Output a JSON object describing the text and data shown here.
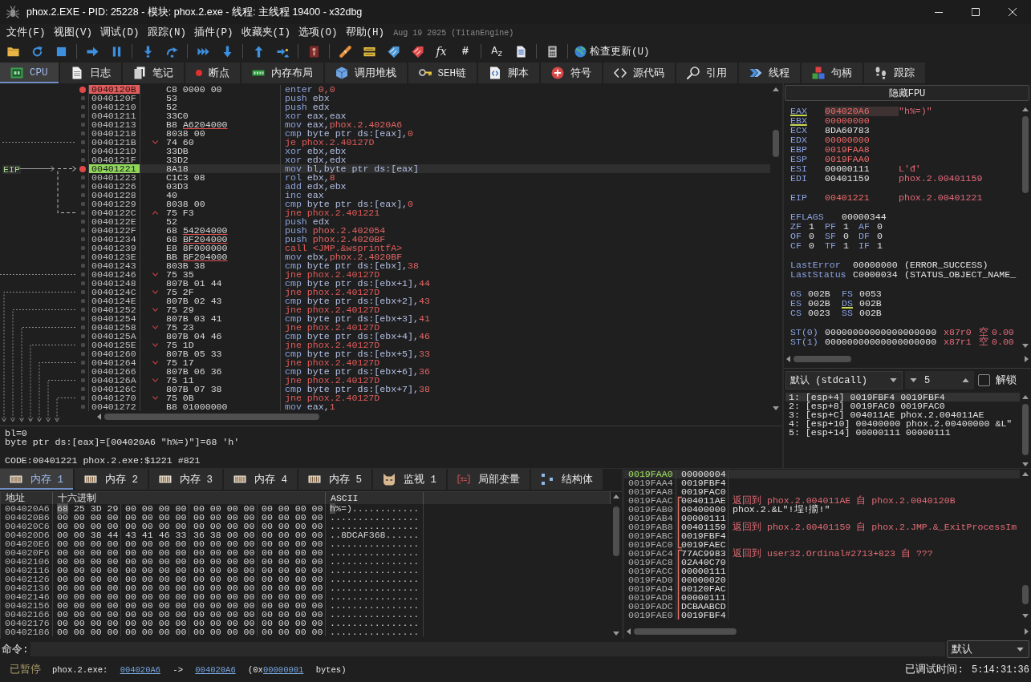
{
  "window": {
    "title": "phox.2.EXE - PID: 25228 - 模块: phox.2.exe - 线程: 主线程 19400 - x32dbg"
  },
  "menu": {
    "items": [
      "文件(F)",
      "视图(V)",
      "调试(D)",
      "跟踪(N)",
      "插件(P)",
      "收藏夹(I)",
      "选项(O)",
      "帮助(H)"
    ],
    "build": "Aug 19 2025 (TitanEngine)"
  },
  "toolbar": {
    "glyphs": [
      "fx",
      "#",
      "A$_{z}$"
    ],
    "update_button": "检查更新(U)"
  },
  "tabs": [
    {
      "label": "CPU",
      "selected": true
    },
    {
      "label": "日志",
      "selected": false
    },
    {
      "label": "笔记",
      "selected": false
    },
    {
      "label": "断点",
      "selected": false
    },
    {
      "label": "内存布局",
      "selected": false
    },
    {
      "label": "调用堆栈",
      "selected": false
    },
    {
      "label": "SEH链",
      "selected": false
    },
    {
      "label": "脚本",
      "selected": false
    },
    {
      "label": "符号",
      "selected": false
    },
    {
      "label": "源代码",
      "selected": false
    },
    {
      "label": "引用",
      "selected": false
    },
    {
      "label": "线程",
      "selected": false
    },
    {
      "label": "句柄",
      "selected": false
    },
    {
      "label": "跟踪",
      "selected": false
    }
  ],
  "disasm": {
    "eip_label": "EIP",
    "rows": [
      {
        "address": "0040120B",
        "bytes": "C8 0000 00",
        "mnemonic": "enter",
        "value": "0,0",
        "kind": "plain",
        "breakpoint": true,
        "current": false
      },
      {
        "address": "0040120F",
        "bytes": "53",
        "mnemonic": "push",
        "operands": "ebx",
        "kind": "plain",
        "breakpoint": false,
        "current": false
      },
      {
        "address": "00401210",
        "bytes": "52",
        "mnemonic": "push",
        "operands": "edx",
        "kind": "plain",
        "breakpoint": false,
        "current": false
      },
      {
        "address": "00401211",
        "bytes": "33C0",
        "mnemonic": "xor",
        "operands": "eax,eax",
        "kind": "plain",
        "breakpoint": false,
        "current": false
      },
      {
        "address": "00401213",
        "bytes": "B8",
        "reloc": "A6204000",
        "mnemonic": "mov",
        "operands": "eax,",
        "value": "phox.2.4020A6",
        "kind": "plain",
        "breakpoint": false,
        "current": false
      },
      {
        "address": "00401218",
        "bytes": "8038 00",
        "mnemonic": "cmp",
        "operands": "byte ptr ds:[eax],",
        "value": "0",
        "kind": "plain",
        "breakpoint": false,
        "current": false
      },
      {
        "address": "0040121B",
        "bytes": "74 60",
        "jump_up": false,
        "mnemonic": "je",
        "value": "phox.2.40127D",
        "kind": "branch",
        "breakpoint": false,
        "current": false
      },
      {
        "address": "0040121D",
        "bytes": "33DB",
        "mnemonic": "xor",
        "operands": "ebx,ebx",
        "kind": "plain",
        "breakpoint": false,
        "current": false
      },
      {
        "address": "0040121F",
        "bytes": "33D2",
        "mnemonic": "xor",
        "operands": "edx,edx",
        "kind": "plain",
        "breakpoint": false,
        "current": false
      },
      {
        "address": "00401221",
        "bytes": "8A18",
        "mnemonic": "mov",
        "operands": "bl,byte ptr ds:[eax]",
        "kind": "plain",
        "breakpoint": true,
        "current": true
      },
      {
        "address": "00401223",
        "bytes": "C1C3 08",
        "mnemonic": "rol",
        "operands": "ebx,",
        "value": "8",
        "kind": "plain",
        "breakpoint": false,
        "current": false
      },
      {
        "address": "00401226",
        "bytes": "03D3",
        "mnemonic": "add",
        "operands": "edx,ebx",
        "kind": "plain",
        "breakpoint": false,
        "current": false
      },
      {
        "address": "00401228",
        "bytes": "40",
        "mnemonic": "inc",
        "operands": "eax",
        "kind": "plain",
        "breakpoint": false,
        "current": false
      },
      {
        "address": "00401229",
        "bytes": "8038 00",
        "mnemonic": "cmp",
        "operands": "byte ptr ds:[eax],",
        "value": "0",
        "kind": "plain",
        "breakpoint": false,
        "current": false
      },
      {
        "address": "0040122C",
        "bytes": "75 F3",
        "jump_up": true,
        "mnemonic": "jne",
        "value": "phox.2.401221",
        "kind": "branch",
        "breakpoint": false,
        "current": false
      },
      {
        "address": "0040122E",
        "bytes": "52",
        "mnemonic": "push",
        "operands": "edx",
        "kind": "plain",
        "breakpoint": false,
        "current": false
      },
      {
        "address": "0040122F",
        "bytes": "68",
        "reloc": "54204000",
        "mnemonic": "push",
        "value": "phox.2.402054",
        "kind": "plain",
        "breakpoint": false,
        "current": false
      },
      {
        "address": "00401234",
        "bytes": "68",
        "reloc": "BF204000",
        "mnemonic": "push",
        "value": "phox.2.4020BF",
        "kind": "plain",
        "breakpoint": false,
        "current": false
      },
      {
        "address": "00401239",
        "bytes": "E8 8F000000",
        "mnemonic": "call",
        "value": "<JMP.&wsprintfA>",
        "kind": "branch",
        "breakpoint": false,
        "current": false
      },
      {
        "address": "0040123E",
        "bytes": "BB",
        "reloc": "BF204000",
        "mnemonic": "mov",
        "operands": "ebx,",
        "value": "phox.2.4020BF",
        "kind": "plain",
        "breakpoint": false,
        "current": false
      },
      {
        "address": "00401243",
        "bytes": "803B 38",
        "mnemonic": "cmp",
        "operands": "byte ptr ds:[ebx],",
        "value": "38",
        "kind": "plain",
        "breakpoint": false,
        "current": false
      },
      {
        "address": "00401246",
        "bytes": "75 35",
        "jump_up": false,
        "mnemonic": "jne",
        "value": "phox.2.40127D",
        "kind": "branch",
        "breakpoint": false,
        "current": false
      },
      {
        "address": "00401248",
        "bytes": "807B 01 44",
        "mnemonic": "cmp",
        "operands": "byte ptr ds:[ebx+1],",
        "value": "44",
        "kind": "plain",
        "breakpoint": false,
        "current": false
      },
      {
        "address": "0040124C",
        "bytes": "75 2F",
        "jump_up": false,
        "mnemonic": "jne",
        "value": "phox.2.40127D",
        "kind": "branch",
        "breakpoint": false,
        "current": false
      },
      {
        "address": "0040124E",
        "bytes": "807B 02 43",
        "mnemonic": "cmp",
        "operands": "byte ptr ds:[ebx+2],",
        "value": "43",
        "kind": "plain",
        "breakpoint": false,
        "current": false
      },
      {
        "address": "00401252",
        "bytes": "75 29",
        "jump_up": false,
        "mnemonic": "jne",
        "value": "phox.2.40127D",
        "kind": "branch",
        "breakpoint": false,
        "current": false
      },
      {
        "address": "00401254",
        "bytes": "807B 03 41",
        "mnemonic": "cmp",
        "operands": "byte ptr ds:[ebx+3],",
        "value": "41",
        "kind": "plain",
        "breakpoint": false,
        "current": false
      },
      {
        "address": "00401258",
        "bytes": "75 23",
        "jump_up": false,
        "mnemonic": "jne",
        "value": "phox.2.40127D",
        "kind": "branch",
        "breakpoint": false,
        "current": false
      },
      {
        "address": "0040125A",
        "bytes": "807B 04 46",
        "mnemonic": "cmp",
        "operands": "byte ptr ds:[ebx+4],",
        "value": "46",
        "kind": "plain",
        "breakpoint": false,
        "current": false
      },
      {
        "address": "0040125E",
        "bytes": "75 1D",
        "jump_up": false,
        "mnemonic": "jne",
        "value": "phox.2.40127D",
        "kind": "branch",
        "breakpoint": false,
        "current": false
      },
      {
        "address": "00401260",
        "bytes": "807B 05 33",
        "mnemonic": "cmp",
        "operands": "byte ptr ds:[ebx+5],",
        "value": "33",
        "kind": "plain",
        "breakpoint": false,
        "current": false
      },
      {
        "address": "00401264",
        "bytes": "75 17",
        "jump_up": false,
        "mnemonic": "jne",
        "value": "phox.2.40127D",
        "kind": "branch",
        "breakpoint": false,
        "current": false
      },
      {
        "address": "00401266",
        "bytes": "807B 06 36",
        "mnemonic": "cmp",
        "operands": "byte ptr ds:[ebx+6],",
        "value": "36",
        "kind": "plain",
        "breakpoint": false,
        "current": false
      },
      {
        "address": "0040126A",
        "bytes": "75 11",
        "jump_up": false,
        "mnemonic": "jne",
        "value": "phox.2.40127D",
        "kind": "branch",
        "breakpoint": false,
        "current": false
      },
      {
        "address": "0040126C",
        "bytes": "807B 07 38",
        "mnemonic": "cmp",
        "operands": "byte ptr ds:[ebx+7],",
        "value": "38",
        "kind": "plain",
        "breakpoint": false,
        "current": false
      },
      {
        "address": "00401270",
        "bytes": "75 0B",
        "jump_up": false,
        "mnemonic": "jne",
        "value": "phox.2.40127D",
        "kind": "branch",
        "breakpoint": false,
        "current": false
      },
      {
        "address": "00401272",
        "bytes": "B8 01000000",
        "mnemonic": "mov",
        "operands": "eax,",
        "value": "1",
        "kind": "plain",
        "breakpoint": false,
        "current": false
      }
    ]
  },
  "info": {
    "lines": [
      "bl=0",
      "byte ptr ds:[eax]=[004020A6 \"h%=)\"]=68 'h'"
    ],
    "code_line": "CODE:00401221 phox.2.exe:$1221 #821"
  },
  "registers": {
    "fpu_button": "隐藏FPU",
    "general": [
      {
        "name": "EAX",
        "value": "004020A6",
        "comment": "\"h%=)\"",
        "changed": true,
        "highlighted": true,
        "selected": true
      },
      {
        "name": "EBX",
        "value": "00000000",
        "changed": true,
        "highlighted": true,
        "selected": false
      },
      {
        "name": "ECX",
        "value": "8DA60783",
        "changed": false,
        "highlighted": false,
        "selected": false
      },
      {
        "name": "EDX",
        "value": "00000000",
        "changed": true,
        "highlighted": false,
        "selected": false
      },
      {
        "name": "EBP",
        "value": "0019FAA8",
        "changed": true,
        "highlighted": false,
        "selected": false
      },
      {
        "name": "ESP",
        "value": "0019FAA0",
        "changed": true,
        "highlighted": false,
        "selected": false
      },
      {
        "name": "ESI",
        "value": "00000111",
        "comment": "L'đ'",
        "changed": false,
        "highlighted": false,
        "selected": false
      },
      {
        "name": "EDI",
        "value": "00401159",
        "comment": "phox.2.00401159",
        "changed": false,
        "highlighted": false,
        "selected": false
      }
    ],
    "eip": {
      "name": "EIP",
      "value": "00401221",
      "comment": "phox.2.00401221",
      "changed": true
    },
    "eflags": {
      "name": "EFLAGS",
      "value": "00000344"
    },
    "flags": [
      {
        "name": "ZF",
        "value": "1"
      },
      {
        "name": "PF",
        "value": "1"
      },
      {
        "name": "AF",
        "value": "0"
      },
      {
        "name": "OF",
        "value": "0"
      },
      {
        "name": "SF",
        "value": "0"
      },
      {
        "name": "DF",
        "value": "0"
      },
      {
        "name": "CF",
        "value": "0"
      },
      {
        "name": "TF",
        "value": "1"
      },
      {
        "name": "IF",
        "value": "1"
      }
    ],
    "last": [
      {
        "name": "LastError",
        "value": "00000000",
        "comment": "(ERROR_SUCCESS)"
      },
      {
        "name": "LastStatus",
        "value": "C0000034",
        "comment": "(STATUS_OBJECT_NAME_"
      }
    ],
    "segments": [
      {
        "name": "GS",
        "value": "002B",
        "highlighted": false
      },
      {
        "name": "FS",
        "value": "0053",
        "highlighted": false
      },
      {
        "name": "ES",
        "value": "002B",
        "highlighted": false
      },
      {
        "name": "DS",
        "value": "002B",
        "highlighted": true
      },
      {
        "name": "CS",
        "value": "0023",
        "highlighted": false
      },
      {
        "name": "SS",
        "value": "002B",
        "highlighted": false
      }
    ],
    "fpu": [
      {
        "name": "ST(0)",
        "value": "00000000000000000000",
        "tag": "x87r0",
        "state": "空",
        "number": "0.00"
      },
      {
        "name": "ST(1)",
        "value": "00000000000000000000",
        "tag": "x87r1",
        "state": "空",
        "number": "0.00"
      }
    ]
  },
  "call_convention": {
    "dropdown": "默认 (stdcall)",
    "count": "5",
    "unlock": {
      "label": "解锁",
      "checked": false
    },
    "args": [
      {
        "text": "1: [esp+4] 0019FBF4 0019FBF4",
        "selected": true
      },
      {
        "text": "2: [esp+8] 0019FAC0 0019FAC0",
        "selected": false
      },
      {
        "text": "3: [esp+C] 004011AE phox.2.004011AE",
        "selected": false
      },
      {
        "text": "4: [esp+10] 00400000 phox.2.00400000 &L\"",
        "selected": false
      },
      {
        "text": "5: [esp+14] 00000111 00000111",
        "selected": false
      }
    ]
  },
  "memory_tabs": [
    {
      "label": "内存 1",
      "selected": true
    },
    {
      "label": "内存 2",
      "selected": false
    },
    {
      "label": "内存 3",
      "selected": false
    },
    {
      "label": "内存 4",
      "selected": false
    },
    {
      "label": "内存 5",
      "selected": false
    },
    {
      "label": "监视 1",
      "selected": false
    },
    {
      "label": "局部变量",
      "selected": false
    },
    {
      "label": "结构体",
      "selected": false
    }
  ],
  "dump": {
    "columns": [
      "地址",
      "十六进制",
      "ASCII"
    ],
    "rows": [
      {
        "address": "004020A6",
        "hex": [
          "68",
          "25",
          "3D",
          "29",
          "00",
          "00",
          "00",
          "00",
          "00",
          "00",
          "00",
          "00",
          "00",
          "00",
          "00",
          "00"
        ],
        "ascii": "h%=)............",
        "selected": true
      },
      {
        "address": "004020B6",
        "hex": [
          "00",
          "00",
          "00",
          "00",
          "00",
          "00",
          "00",
          "00",
          "00",
          "00",
          "00",
          "00",
          "00",
          "00",
          "00",
          "00"
        ],
        "ascii": "................",
        "selected": false
      },
      {
        "address": "004020C6",
        "hex": [
          "00",
          "00",
          "00",
          "00",
          "00",
          "00",
          "00",
          "00",
          "00",
          "00",
          "00",
          "00",
          "00",
          "00",
          "00",
          "00"
        ],
        "ascii": "................",
        "selected": false
      },
      {
        "address": "004020D6",
        "hex": [
          "00",
          "00",
          "38",
          "44",
          "43",
          "41",
          "46",
          "33",
          "36",
          "38",
          "00",
          "00",
          "00",
          "00",
          "00",
          "00"
        ],
        "ascii": "..8DCAF368......",
        "selected": false
      },
      {
        "address": "004020E6",
        "hex": [
          "00",
          "00",
          "00",
          "00",
          "00",
          "00",
          "00",
          "00",
          "00",
          "00",
          "00",
          "00",
          "00",
          "00",
          "00",
          "00"
        ],
        "ascii": "................",
        "selected": false
      },
      {
        "address": "004020F6",
        "hex": [
          "00",
          "00",
          "00",
          "00",
          "00",
          "00",
          "00",
          "00",
          "00",
          "00",
          "00",
          "00",
          "00",
          "00",
          "00",
          "00"
        ],
        "ascii": "................",
        "selected": false
      },
      {
        "address": "00402106",
        "hex": [
          "00",
          "00",
          "00",
          "00",
          "00",
          "00",
          "00",
          "00",
          "00",
          "00",
          "00",
          "00",
          "00",
          "00",
          "00",
          "00"
        ],
        "ascii": "................",
        "selected": false
      },
      {
        "address": "00402116",
        "hex": [
          "00",
          "00",
          "00",
          "00",
          "00",
          "00",
          "00",
          "00",
          "00",
          "00",
          "00",
          "00",
          "00",
          "00",
          "00",
          "00"
        ],
        "ascii": "................",
        "selected": false
      },
      {
        "address": "00402126",
        "hex": [
          "00",
          "00",
          "00",
          "00",
          "00",
          "00",
          "00",
          "00",
          "00",
          "00",
          "00",
          "00",
          "00",
          "00",
          "00",
          "00"
        ],
        "ascii": "................",
        "selected": false
      },
      {
        "address": "00402136",
        "hex": [
          "00",
          "00",
          "00",
          "00",
          "00",
          "00",
          "00",
          "00",
          "00",
          "00",
          "00",
          "00",
          "00",
          "00",
          "00",
          "00"
        ],
        "ascii": "................",
        "selected": false
      },
      {
        "address": "00402146",
        "hex": [
          "00",
          "00",
          "00",
          "00",
          "00",
          "00",
          "00",
          "00",
          "00",
          "00",
          "00",
          "00",
          "00",
          "00",
          "00",
          "00"
        ],
        "ascii": "................",
        "selected": false
      },
      {
        "address": "00402156",
        "hex": [
          "00",
          "00",
          "00",
          "00",
          "00",
          "00",
          "00",
          "00",
          "00",
          "00",
          "00",
          "00",
          "00",
          "00",
          "00",
          "00"
        ],
        "ascii": "................",
        "selected": false
      },
      {
        "address": "00402166",
        "hex": [
          "00",
          "00",
          "00",
          "00",
          "00",
          "00",
          "00",
          "00",
          "00",
          "00",
          "00",
          "00",
          "00",
          "00",
          "00",
          "00"
        ],
        "ascii": "................",
        "selected": false
      },
      {
        "address": "00402176",
        "hex": [
          "00",
          "00",
          "00",
          "00",
          "00",
          "00",
          "00",
          "00",
          "00",
          "00",
          "00",
          "00",
          "00",
          "00",
          "00",
          "00"
        ],
        "ascii": "................",
        "selected": false
      },
      {
        "address": "00402186",
        "hex": [
          "00",
          "00",
          "00",
          "00",
          "00",
          "00",
          "00",
          "00",
          "00",
          "00",
          "00",
          "00",
          "00",
          "00",
          "00",
          "00"
        ],
        "ascii": "................",
        "selected": false
      }
    ]
  },
  "stack": {
    "rows": [
      {
        "address": "0019FAA0",
        "value": "00000004",
        "selected": true
      },
      {
        "address": "0019FAA4",
        "value": "0019FBF4",
        "selected": false
      },
      {
        "address": "0019FAA8",
        "value": "0019FAC0",
        "selected": false
      }
    ],
    "frames": [
      {
        "closed": true,
        "rows": [
          {
            "address": "0019FAAC",
            "value": "004011AE",
            "selected": false,
            "comment": {
              "text": "返回到 phox.2.004011AE 自 phox.2.0040120B",
              "kind": "return"
            }
          },
          {
            "address": "0019FAB0",
            "value": "00400000",
            "selected": false,
            "comment": {
              "text": "phox.2.&L\"!埕!擶!\"",
              "kind": "plain"
            }
          },
          {
            "address": "0019FAB4",
            "value": "00000111",
            "selected": false
          },
          {
            "address": "0019FAB8",
            "value": "00401159",
            "selected": false,
            "comment": {
              "text": "返回到 phox.2.00401159 自 phox.2.JMP.&_ExitProcessIm",
              "kind": "return"
            }
          },
          {
            "address": "0019FABC",
            "value": "0019FBF4",
            "selected": false
          },
          {
            "address": "0019FAC0",
            "value": "0019FAEC",
            "selected": false
          }
        ]
      },
      {
        "closed": false,
        "rows": [
          {
            "address": "0019FAC4",
            "value": "77AC9983",
            "selected": false,
            "comment": {
              "text": "返回到 user32.Ordinal#2713+823 自 ???",
              "kind": "return"
            }
          },
          {
            "address": "0019FAC8",
            "value": "02A40C70",
            "selected": false
          },
          {
            "address": "0019FACC",
            "value": "00000111",
            "selected": false
          },
          {
            "address": "0019FAD0",
            "value": "00000020",
            "selected": false
          },
          {
            "address": "0019FAD4",
            "value": "00120FAC",
            "selected": false
          },
          {
            "address": "0019FAD8",
            "value": "00000111",
            "selected": false
          },
          {
            "address": "0019FADC",
            "value": "DCBAABCD",
            "selected": false
          },
          {
            "address": "0019FAE0",
            "value": "0019FBF4",
            "selected": false
          }
        ]
      }
    ]
  },
  "command": {
    "label": "命令:",
    "dropdown": "默认"
  },
  "status_bar": {
    "state": "已暂停",
    "message": [
      {
        "text": "phox.2.exe:",
        "link": false
      },
      {
        "text": "004020A6",
        "link": true
      },
      {
        "text": "->",
        "link": false
      },
      {
        "text": "004020A6",
        "link": true
      },
      {
        "prefix": "(0x",
        "text": "00000001",
        "link": true
      },
      {
        "text": "bytes)",
        "link": false
      }
    ],
    "timer_label": "已调试时间:",
    "timer": "5:14:31:36"
  }
}
